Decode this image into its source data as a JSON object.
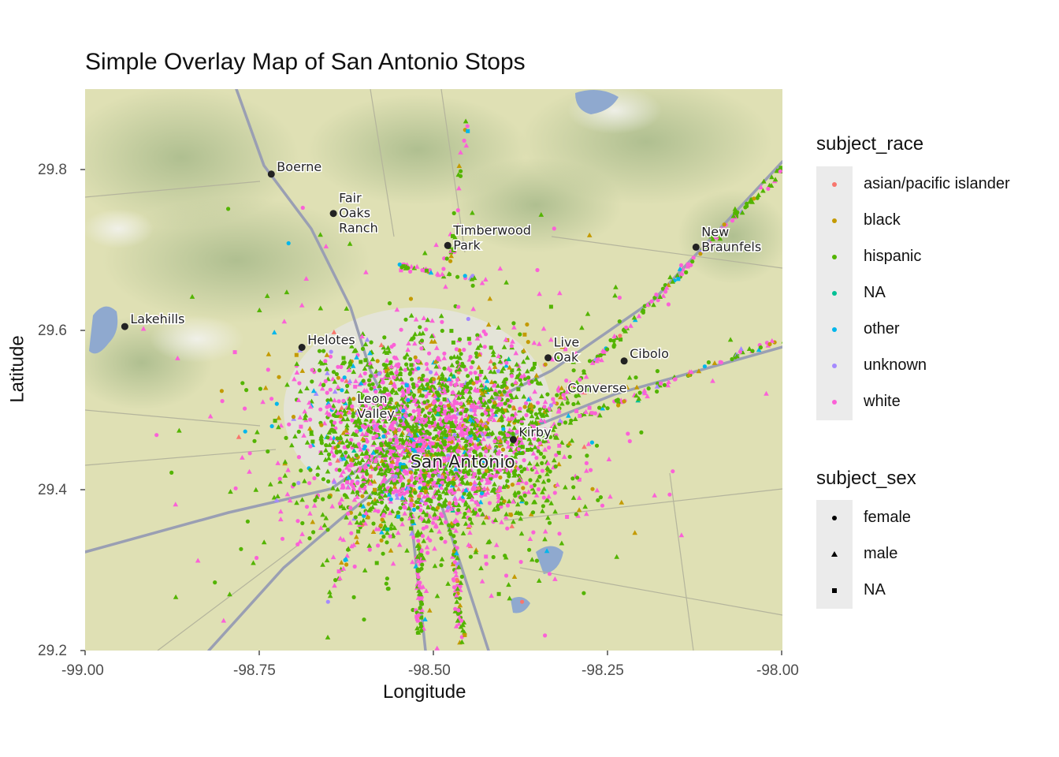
{
  "title": "Simple Overlay Map of San Antonio Stops",
  "chart_data": {
    "type": "scatter",
    "title": "Simple Overlay Map of San Antonio Stops",
    "xlabel": "Longitude",
    "ylabel": "Latitude",
    "xlim": [
      -99.0,
      -98.0
    ],
    "ylim": [
      29.2,
      29.9
    ],
    "x_ticks": [
      "-99.00",
      "-98.75",
      "-98.50",
      "-98.25",
      "-98.00"
    ],
    "y_ticks": [
      "29.2",
      "29.4",
      "29.6",
      "29.8"
    ],
    "basemap": "terrain tiles",
    "legend_position": "right",
    "color_legend": {
      "title": "subject_race",
      "entries": [
        {
          "label": "asian/pacific islander",
          "color": "#F8766D"
        },
        {
          "label": "black",
          "color": "#C49A00"
        },
        {
          "label": "hispanic",
          "color": "#53B400"
        },
        {
          "label": "NA",
          "color": "#00C094"
        },
        {
          "label": "other",
          "color": "#00B6EB"
        },
        {
          "label": "unknown",
          "color": "#A58AFF"
        },
        {
          "label": "white",
          "color": "#FB61D7"
        }
      ]
    },
    "shape_legend": {
      "title": "subject_sex",
      "entries": [
        {
          "label": "female",
          "shape": "circle"
        },
        {
          "label": "male",
          "shape": "triangle"
        },
        {
          "label": "NA",
          "shape": "square"
        }
      ]
    },
    "places": [
      {
        "name": "Boerne",
        "lon": -98.733,
        "lat": 29.794
      },
      {
        "name": "Fair Oaks Ranch",
        "lon": -98.644,
        "lat": 29.745
      },
      {
        "name": "Timberwood Park",
        "lon": -98.48,
        "lat": 29.705
      },
      {
        "name": "New Braunfels",
        "lon": -98.124,
        "lat": 29.703
      },
      {
        "name": "Lakehills",
        "lon": -98.943,
        "lat": 29.604
      },
      {
        "name": "Helotes",
        "lon": -98.689,
        "lat": 29.578
      },
      {
        "name": "Live Oak",
        "lon": -98.336,
        "lat": 29.565
      },
      {
        "name": "Cibolo",
        "lon": -98.227,
        "lat": 29.561
      },
      {
        "name": "Converse",
        "lon": -98.316,
        "lat": 29.518
      },
      {
        "name": "Kirby",
        "lon": -98.386,
        "lat": 29.463
      },
      {
        "name": "Leon Valley",
        "lon": -98.618,
        "lat": 29.495
      },
      {
        "name": "San Antonio",
        "lon": -98.494,
        "lat": 29.424
      }
    ]
  }
}
